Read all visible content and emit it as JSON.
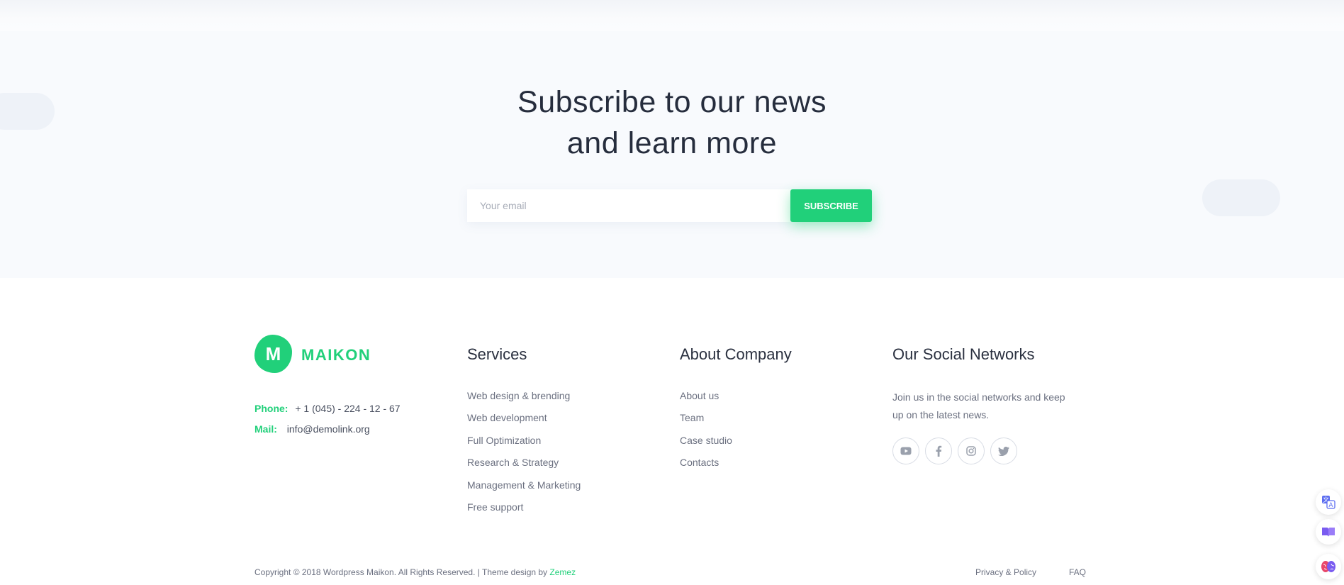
{
  "subscribe": {
    "title_line1": "Subscribe to our news",
    "title_line2": "and learn more",
    "email_placeholder": "Your email",
    "button_label": "SUBSCRIBE"
  },
  "brand": {
    "logo_letter": "M",
    "name": "MAIKON",
    "accent_color": "#21d07a"
  },
  "contact": {
    "phone_label": "Phone:",
    "phone_value": "+ 1 (045) - 224 - 12 - 67",
    "mail_label": "Mail:",
    "mail_value": "info@demolink.org"
  },
  "services": {
    "title": "Services",
    "links": [
      "Web design & brending",
      "Web development",
      "Full Optimization",
      "Research & Strategy",
      "Management & Marketing",
      "Free support"
    ]
  },
  "about": {
    "title": "About Company",
    "links": [
      "About us",
      "Team",
      "Case studio",
      "Contacts"
    ]
  },
  "social": {
    "title": "Our Social Networks",
    "description": "Join us in the social networks and keep up on the latest news.",
    "icons": [
      "youtube-icon",
      "facebook-icon",
      "instagram-icon",
      "twitter-icon"
    ]
  },
  "bottom": {
    "copyright": "Copyright © 2018 Wordpress Maikon. All Rights Reserved. | Theme design by ",
    "designer": "Zemez",
    "links": [
      "Privacy & Policy",
      "FAQ"
    ]
  },
  "side_widgets": [
    "translate-icon",
    "reader-icon",
    "brain-icon"
  ]
}
